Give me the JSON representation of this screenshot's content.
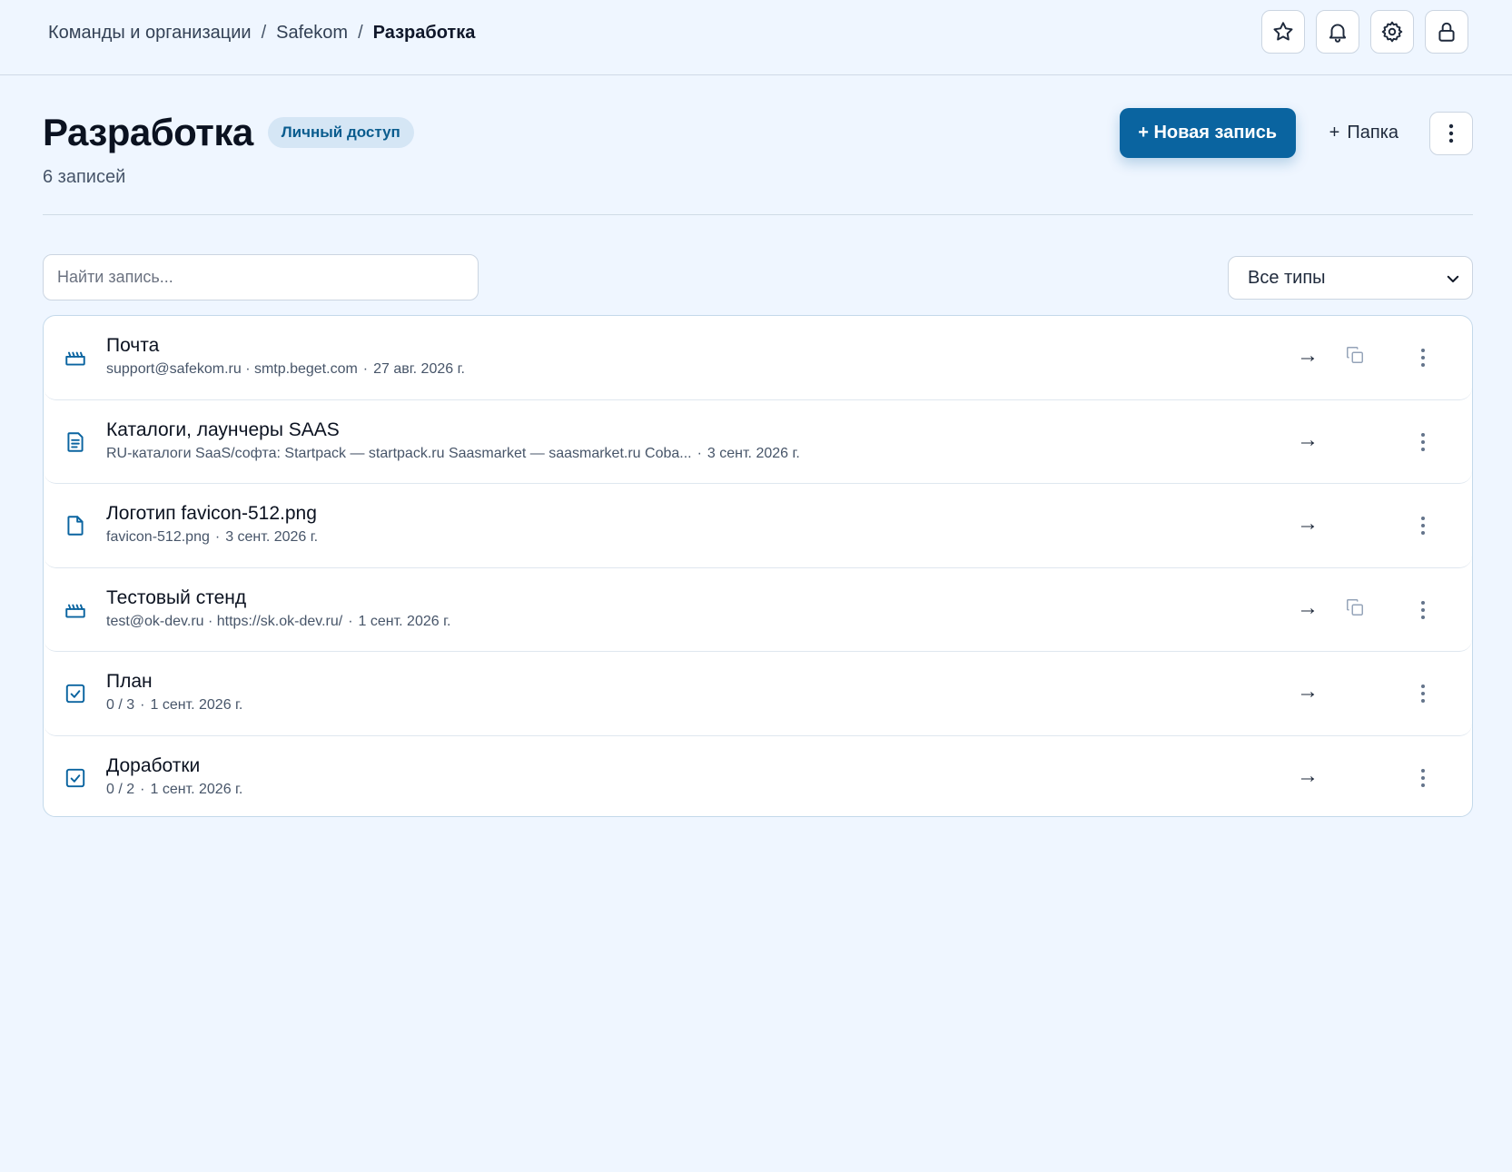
{
  "breadcrumb": {
    "items": [
      "Команды и организации",
      "Safekom"
    ],
    "separator": "/",
    "current": "Разработка"
  },
  "top_icons": [
    "star-icon",
    "bell-icon",
    "gear-icon",
    "lock-icon"
  ],
  "header": {
    "title": "Разработка",
    "badge": "Личный доступ",
    "count": "6 записей",
    "new_record_label": "+ Новая запись",
    "folder_plus": "+",
    "folder_label": "Папка"
  },
  "filters": {
    "search_placeholder": "Найти запись...",
    "type_selected": "Все типы"
  },
  "colors": {
    "accent": "#0a64a0",
    "badge_bg": "#d5e6f5",
    "page_bg": "#eff6ff"
  },
  "records": [
    {
      "icon": "login-icon",
      "title": "Почта",
      "subtitle": "support@safekom.ru · smtp.beget.com",
      "date": "27 авг. 2026 г.",
      "has_copy": true
    },
    {
      "icon": "note-icon",
      "title": "Каталоги, лаунчеры SAAS",
      "subtitle": "RU-каталоги SaaS/софта: Startpack — startpack.ru Saasmarket — saasmarket.ru Coba...",
      "date": "3 сент. 2026 г.",
      "has_copy": false
    },
    {
      "icon": "file-icon",
      "title": "Логотип favicon-512.png",
      "subtitle": "favicon-512.png",
      "date": "3 сент. 2026 г.",
      "has_copy": false
    },
    {
      "icon": "login-icon",
      "title": "Тестовый стенд",
      "subtitle": "test@ok-dev.ru · https://sk.ok-dev.ru/",
      "date": "1 сент. 2026 г.",
      "has_copy": true
    },
    {
      "icon": "checklist-icon",
      "title": "План",
      "subtitle": "0 / 3",
      "date": "1 сент. 2026 г.",
      "has_copy": false
    },
    {
      "icon": "checklist-icon",
      "title": "Доработки",
      "subtitle": "0 / 2",
      "date": "1 сент. 2026 г.",
      "has_copy": false
    }
  ],
  "row_arrow": "→",
  "row_dot": "·"
}
